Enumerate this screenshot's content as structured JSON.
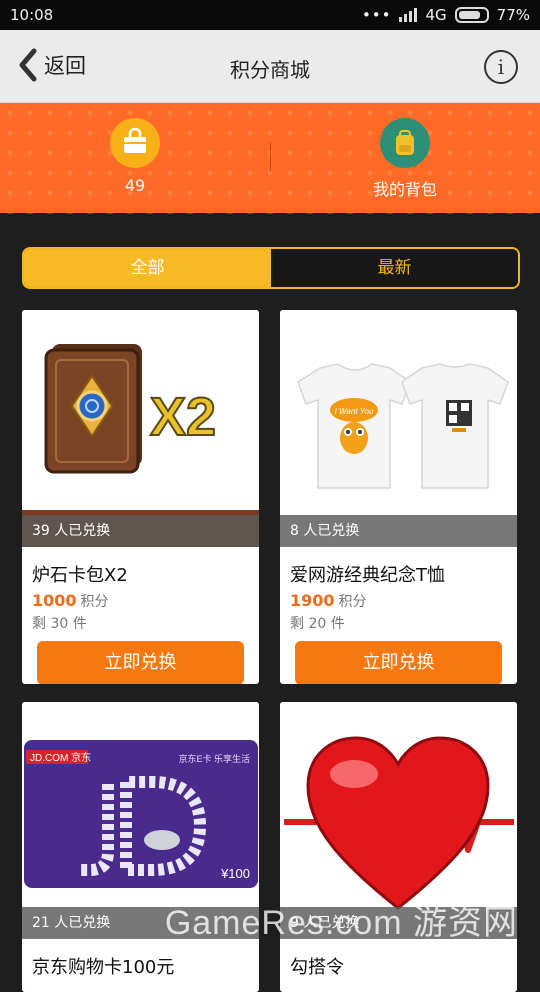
{
  "status_bar": {
    "time": "10:08",
    "network": "4G",
    "battery": "77%"
  },
  "nav": {
    "back_label": "返回",
    "title": "积分商城"
  },
  "banner": {
    "points": "49",
    "bag_label": "我的背包"
  },
  "tabs": [
    {
      "label": "全部",
      "active": true
    },
    {
      "label": "最新",
      "active": false
    }
  ],
  "products": [
    {
      "exchanged": "39 人已兑换",
      "name": "炉石卡包X2",
      "price": "1000",
      "price_unit": "积分",
      "stock": "剩 30 件",
      "button": "立即兑换",
      "card_text": "X2"
    },
    {
      "exchanged": "8 人已兑换",
      "name": "爱网游经典纪念T恤",
      "price": "1900",
      "price_unit": "积分",
      "stock": "剩 20 件",
      "button": "立即兑换",
      "shirt_text": "I Want You"
    },
    {
      "exchanged": "21 人已兑换",
      "name": "京东购物卡100元",
      "jd_logo": "JD.COM 京东",
      "jd_slogan": "京东E卡 乐享生活",
      "jd_value": "¥100"
    },
    {
      "exchanged": "9 人已兑换",
      "name": "勾搭令"
    }
  ],
  "watermark": "GameRes.com 游资网",
  "colors": {
    "banner": "#ff6a26",
    "tab_active": "#f7b924",
    "button": "#f6780f",
    "price": "#f26b19"
  }
}
